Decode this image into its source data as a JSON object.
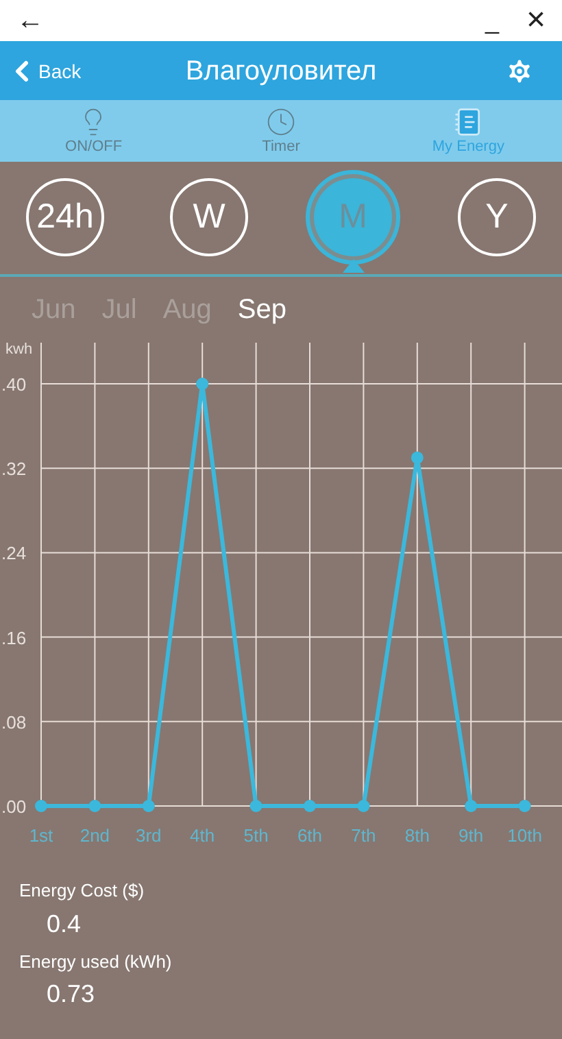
{
  "window": {
    "back": "←",
    "minimize": "_",
    "close": "×"
  },
  "header": {
    "back": "Back",
    "title": "Влагоуловител"
  },
  "tabs": [
    {
      "label": "ON/OFF",
      "kind": "bulb",
      "selected": false
    },
    {
      "label": "Timer",
      "kind": "clock",
      "selected": false
    },
    {
      "label": "My Energy",
      "kind": "notepad",
      "selected": true
    }
  ],
  "periods": [
    {
      "label": "24h",
      "selected": false
    },
    {
      "label": "W",
      "selected": false
    },
    {
      "label": "M",
      "selected": true
    },
    {
      "label": "Y",
      "selected": false
    }
  ],
  "months": [
    {
      "label": "Jun",
      "selected": false
    },
    {
      "label": "Jul",
      "selected": false
    },
    {
      "label": "Aug",
      "selected": false
    },
    {
      "label": "Sep",
      "selected": true
    }
  ],
  "chart_data": {
    "type": "line",
    "ylabel": "kwh",
    "categories": [
      "1st",
      "2nd",
      "3rd",
      "4th",
      "5th",
      "6th",
      "7th",
      "8th",
      "9th",
      "10th"
    ],
    "series": [
      {
        "color": "#3bb8dc",
        "marker": "circle",
        "values": [
          0,
          0,
          0,
          0.4,
          0,
          0,
          0,
          0.33,
          0,
          0
        ]
      }
    ],
    "grid": true,
    "ylim": [
      0,
      0.4
    ],
    "yticks": [
      {
        "value": 0,
        "label": ".00"
      },
      {
        "value": 0.08,
        "label": ".08"
      },
      {
        "value": 0.16,
        "label": ".16"
      },
      {
        "value": 0.24,
        "label": ".24"
      },
      {
        "value": 0.32,
        "label": ".32"
      },
      {
        "value": 0.4,
        "label": ".40"
      }
    ]
  },
  "stats": [
    {
      "label": "Energy Cost ($)",
      "value": "0.4"
    },
    {
      "label": "Energy used (kWh)",
      "value": "0.73"
    }
  ]
}
